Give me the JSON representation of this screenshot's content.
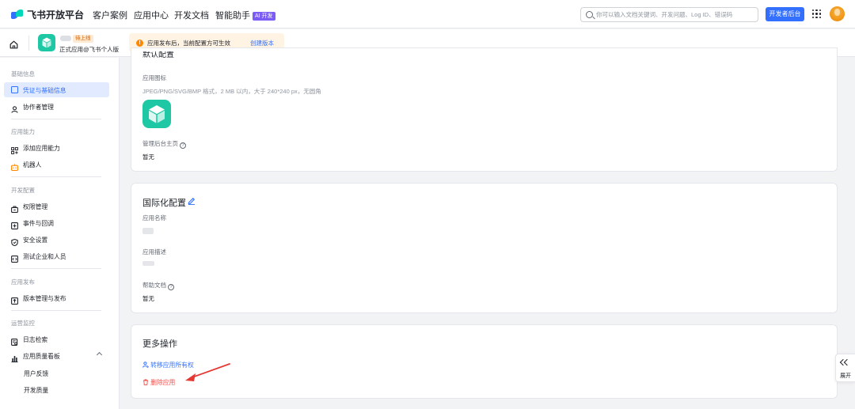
{
  "topnav": {
    "logo_text": "飞书开放平台",
    "items": [
      {
        "label": "客户案例"
      },
      {
        "label": "应用中心"
      },
      {
        "label": "开发文档"
      },
      {
        "label": "智能助手",
        "badge": "AI 开发"
      }
    ],
    "search_placeholder": "你可以输入文档关键词、开发问题、Log ID、错误码",
    "dev_console_button": "开发者后台"
  },
  "appbar": {
    "status_tag": "待上线",
    "app_subtitle": "正式应用@飞书个人版",
    "notice_text": "应用发布后，当前配置方可生效",
    "notice_link": "创建版本"
  },
  "sidebar": {
    "sections": [
      {
        "title": "基础信息",
        "items": [
          "凭证与基础信息",
          "协作者管理"
        ]
      },
      {
        "title": "应用能力",
        "items": [
          "添加应用能力",
          "机器人"
        ]
      },
      {
        "title": "开发配置",
        "items": [
          "权限管理",
          "事件与回调",
          "安全设置",
          "测试企业和人员"
        ]
      },
      {
        "title": "应用发布",
        "items": [
          "版本管理与发布"
        ]
      },
      {
        "title": "运营监控",
        "items": [
          "日志检索",
          "应用质量看板",
          "用户反馈",
          "开发质量"
        ]
      }
    ],
    "active_item": "凭证与基础信息"
  },
  "basic_card": {
    "cut_title": "默认配置",
    "icon_label": "应用图标",
    "icon_hint": "JPEG/PNG/SVG/BMP 格式，2 MB 以内，大于 240*240 px，无圆角",
    "admin_home_label": "管理后台主页",
    "admin_home_value": "暂无"
  },
  "i18n_card": {
    "title": "国际化配置",
    "app_name_label": "应用名称",
    "app_desc_label": "应用描述",
    "help_doc_label": "帮助文档",
    "help_doc_value": "暂无"
  },
  "more_card": {
    "title": "更多操作",
    "transfer_link": "转移应用所有权",
    "delete_link": "删除应用"
  },
  "expand_button": "展开",
  "colors": {
    "primary": "#3370ff",
    "danger": "#f54a45",
    "app_icon": "#1ec8a5",
    "warning": "#ff8800"
  }
}
